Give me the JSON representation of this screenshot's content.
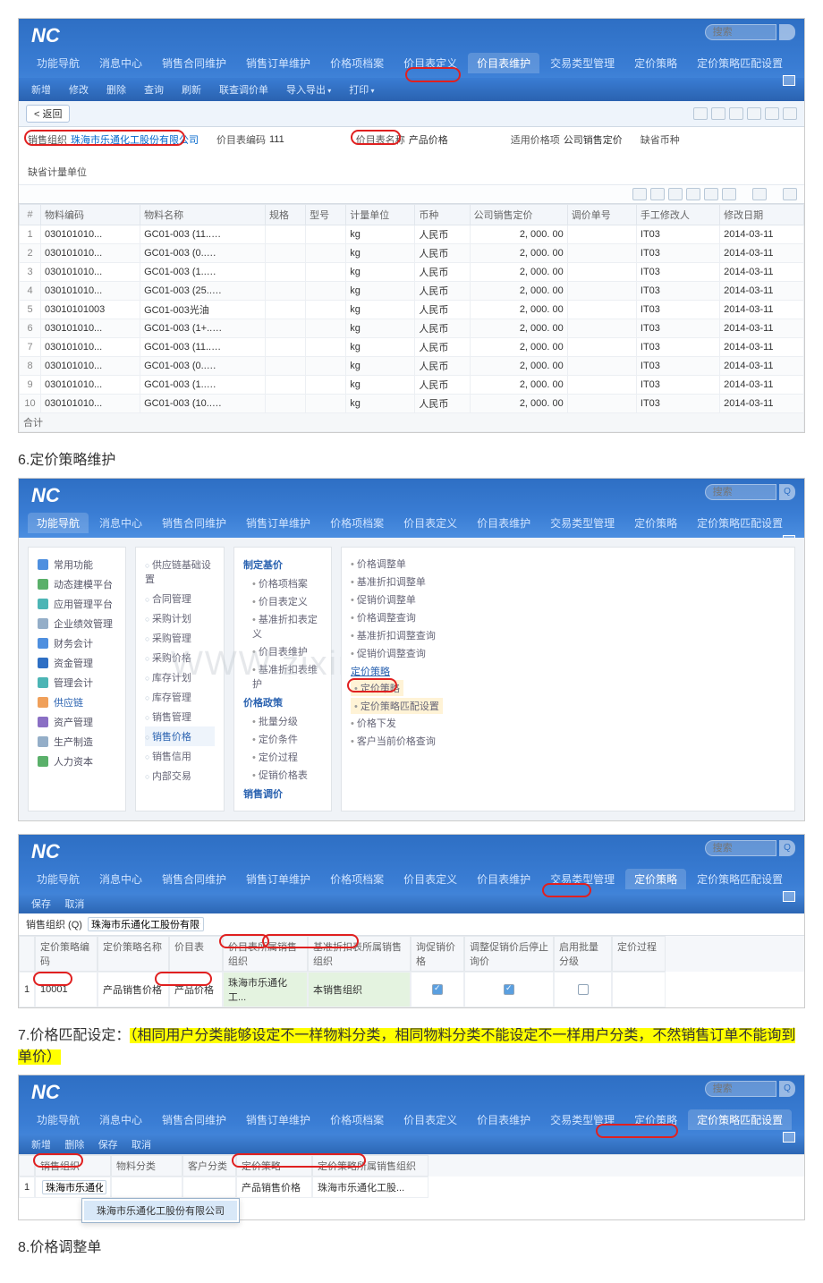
{
  "logo": "NC",
  "search_placeholder": "搜索",
  "sec1": {
    "tabs": [
      "功能导航",
      "消息中心",
      "销售合同维护",
      "销售订单维护",
      "价格项档案",
      "价目表定义",
      "价目表维护",
      "交易类型管理",
      "定价策略",
      "定价策略匹配设置"
    ],
    "active_tab": 6,
    "toolbar": [
      "新增",
      "修改",
      "删除",
      "查询",
      "刷新",
      "联查调价单",
      "导入导出",
      "打印"
    ],
    "back": "< 返回",
    "fields": {
      "org_label": "销售组织",
      "org_value": "珠海市乐通化工股份有限公司",
      "code_label": "价目表编码",
      "code_value": "111",
      "name_label": "价目表名称",
      "name_value": "产品价格",
      "applied_label": "适用价格项",
      "applied_value": "公司销售定价",
      "currency_label": "缺省币种",
      "unit_label": "缺省计量单位"
    },
    "columns": [
      "#",
      "物料编码",
      "物料名称",
      "规格",
      "型号",
      "计量单位",
      "币种",
      "公司销售定价",
      "调价单号",
      "手工修改人",
      "修改日期"
    ],
    "rows": [
      [
        "1",
        "030101010...",
        "GC01-003 (11..…",
        "",
        "",
        "kg",
        "人民币",
        "2, 000. 00",
        "",
        "IT03",
        "2014-03-11"
      ],
      [
        "2",
        "030101010...",
        "GC01-003 (0..…",
        "",
        "",
        "kg",
        "人民币",
        "2, 000. 00",
        "",
        "IT03",
        "2014-03-11"
      ],
      [
        "3",
        "030101010...",
        "GC01-003 (1..…",
        "",
        "",
        "kg",
        "人民币",
        "2, 000. 00",
        "",
        "IT03",
        "2014-03-11"
      ],
      [
        "4",
        "030101010...",
        "GC01-003 (25..…",
        "",
        "",
        "kg",
        "人民币",
        "2, 000. 00",
        "",
        "IT03",
        "2014-03-11"
      ],
      [
        "5",
        "03010101003",
        "GC01-003光油",
        "",
        "",
        "kg",
        "人民币",
        "2, 000. 00",
        "",
        "IT03",
        "2014-03-11"
      ],
      [
        "6",
        "030101010...",
        "GC01-003 (1+..…",
        "",
        "",
        "kg",
        "人民币",
        "2, 000. 00",
        "",
        "IT03",
        "2014-03-11"
      ],
      [
        "7",
        "030101010...",
        "GC01-003 (11..…",
        "",
        "",
        "kg",
        "人民币",
        "2, 000. 00",
        "",
        "IT03",
        "2014-03-11"
      ],
      [
        "8",
        "030101010...",
        "GC01-003 (0..…",
        "",
        "",
        "kg",
        "人民币",
        "2, 000. 00",
        "",
        "IT03",
        "2014-03-11"
      ],
      [
        "9",
        "030101010...",
        "GC01-003 (1..…",
        "",
        "",
        "kg",
        "人民币",
        "2, 000. 00",
        "",
        "IT03",
        "2014-03-11"
      ],
      [
        "10",
        "030101010...",
        "GC01-003 (10..…",
        "",
        "",
        "kg",
        "人民币",
        "2, 000. 00",
        "",
        "IT03",
        "2014-03-11"
      ]
    ],
    "sum_label": "合计"
  },
  "title2": "6.定价策略维护",
  "sec2": {
    "tabs": [
      "功能导航",
      "消息中心",
      "销售合同维护",
      "销售订单维护",
      "价格项档案",
      "价目表定义",
      "价目表维护",
      "交易类型管理",
      "定价策略",
      "定价策略匹配设置"
    ],
    "col1": [
      {
        "icon": "ico-blue",
        "label": "常用功能"
      },
      {
        "icon": "ico-green",
        "label": "动态建模平台"
      },
      {
        "icon": "ico-teal",
        "label": "应用管理平台"
      },
      {
        "icon": "ico-grey",
        "label": "企业绩效管理"
      },
      {
        "icon": "ico-blue",
        "label": "财务会计"
      },
      {
        "icon": "ico-dkblue",
        "label": "资金管理"
      },
      {
        "icon": "ico-teal",
        "label": "管理会计"
      },
      {
        "icon": "ico-orange",
        "label": "供应链",
        "active": true
      },
      {
        "icon": "ico-purple",
        "label": "资产管理"
      },
      {
        "icon": "ico-grey",
        "label": "生产制造"
      },
      {
        "icon": "ico-green",
        "label": "人力资本"
      }
    ],
    "col2": [
      "供应链基础设置",
      "合同管理",
      "采购计划",
      "采购管理",
      "采购价格",
      "库存计划",
      "库存管理",
      "销售管理",
      "销售价格",
      "销售信用",
      "内部交易"
    ],
    "col2_selected": 8,
    "col3": {
      "g1_title": "制定基价",
      "g1_items": [
        "价格项档案",
        "价目表定义",
        "基准折扣表定义",
        "价目表维护",
        "基准折扣表维护"
      ],
      "g2_title": "价格政策",
      "g2_items": [
        "批量分级",
        "定价条件",
        "定价过程",
        "促销价格表"
      ],
      "g3_title": "销售调价"
    },
    "col4": {
      "block1": [
        "价格调整单",
        "基准折扣调整单",
        "促销价调整单",
        "价格调整查询",
        "基准折扣调整查询",
        "促销价调整查询"
      ],
      "sub_title": "定价策略",
      "block2": [
        "定价策略",
        "定价策略匹配设置"
      ],
      "block3": [
        "价格下发",
        "客户当前价格查询"
      ]
    },
    "watermark": "WWW.zixin.com.cn"
  },
  "sec3": {
    "tabs": [
      "功能导航",
      "消息中心",
      "销售合同维护",
      "销售订单维护",
      "价格项档案",
      "价目表定义",
      "价目表维护",
      "交易类型管理",
      "定价策略",
      "定价策略匹配设置"
    ],
    "active_tab": 8,
    "toolbar2": [
      "保存",
      "取消"
    ],
    "org_label": "销售组织 (Q)",
    "org_value": "珠海市乐通化工股份有限公司",
    "hdrs": [
      "",
      "定价策略编码",
      "定价策略名称",
      "价目表",
      "价目表所属销售组织",
      "基准折扣表所属销售组织",
      "询促销价格",
      "调整促销价后停止询价",
      "启用批量分级",
      "定价过程"
    ],
    "widths": [
      18,
      70,
      80,
      60,
      95,
      115,
      60,
      100,
      65,
      60
    ],
    "row": [
      "1",
      "10001",
      "产品销售价格",
      "产品价格",
      "珠海市乐通化工...",
      "本销售组织",
      "on",
      "on",
      "",
      ""
    ]
  },
  "title3_a": "7.价格匹配设定：",
  "title3_b": "（相同用户分类能够设定不一样物料分类，相同物料分类不能设定不一样用户分类，不然销售订单不能询到单价）",
  "sec4": {
    "tabs": [
      "功能导航",
      "消息中心",
      "销售合同维护",
      "销售订单维护",
      "价格项档案",
      "价目表定义",
      "价目表维护",
      "交易类型管理",
      "定价策略",
      "定价策略匹配设置"
    ],
    "active_tab": 9,
    "toolbar": [
      "新增",
      "删除",
      "保存",
      "取消"
    ],
    "hdrs": [
      "",
      "销售组织",
      "物料分类",
      "客户分类",
      "定价策略",
      "定价策略所属销售组织"
    ],
    "widths": [
      18,
      85,
      80,
      60,
      85,
      130
    ],
    "row": [
      "1",
      "珠海市乐通化...",
      "",
      "",
      "产品销售价格",
      "珠海市乐通化工股..."
    ],
    "dropdown_opt": "珠海市乐通化工股份有限公司"
  },
  "title4": "8.价格调整单"
}
